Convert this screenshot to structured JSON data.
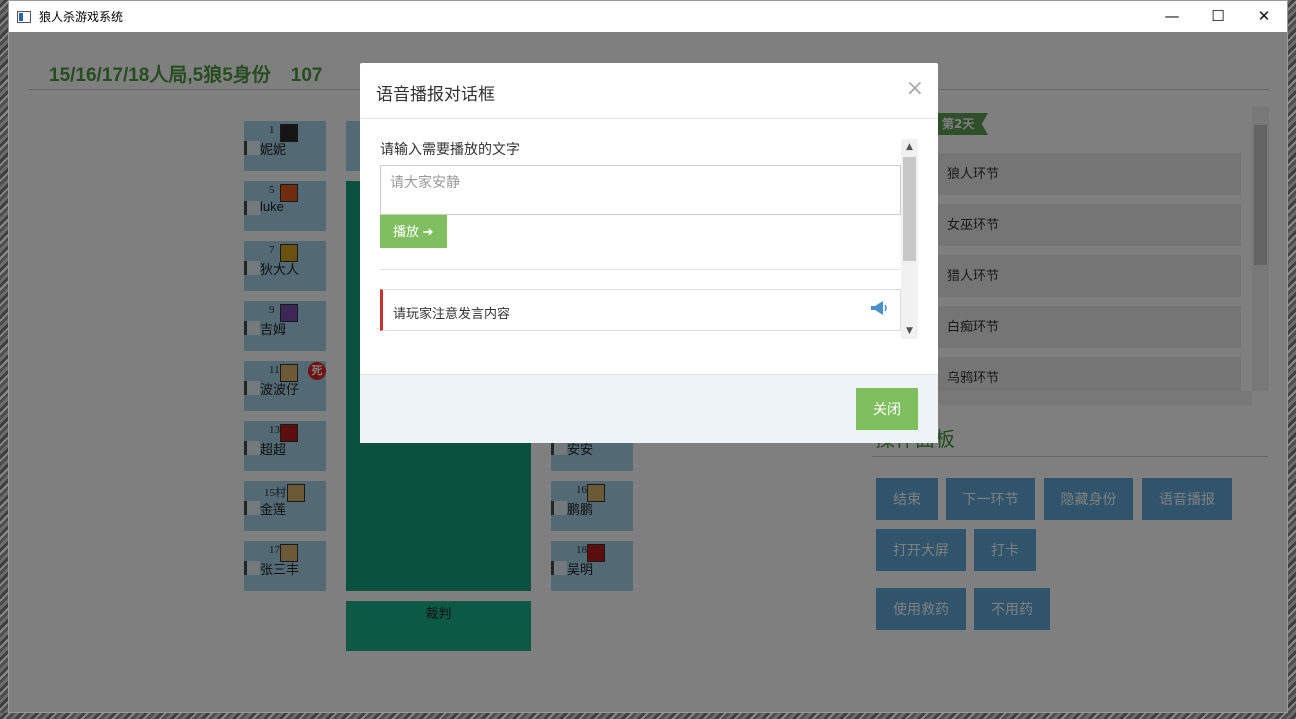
{
  "window": {
    "title": "狼人杀游戏系统",
    "controls": {
      "minimize": "—",
      "maximize": "☐",
      "close": "✕"
    }
  },
  "header": {
    "game_mode": "15/16/17/18人局,5狼5身份",
    "room_partial": "107",
    "flow_title_partial": "程"
  },
  "seats": [
    {
      "num": "1",
      "name": "妮妮",
      "role_color": "#2b2b2b",
      "dead": false
    },
    {
      "num": "5",
      "name": "luke",
      "role_color": "#e05a1a",
      "dead": false
    },
    {
      "num": "7",
      "name": "狄大人",
      "role_color": "#d6a21c",
      "dead": false
    },
    {
      "num": "9",
      "name": "吉姆",
      "role_color": "#7a4fb3",
      "dead": false
    },
    {
      "num": "11",
      "name": "波波仔",
      "role_color": "#d9b26a",
      "dead": true,
      "dead_label": "死"
    },
    {
      "num": "13",
      "name": "超超",
      "role_color": "#b81a1a",
      "dead": false
    },
    {
      "num": "15",
      "num_suffix": "村",
      "name": "金莲",
      "role_color": "#d9b26a",
      "dead": false
    },
    {
      "num": "17",
      "name": "张三丰",
      "role_color": "#d9b26a",
      "dead": false
    },
    {
      "num": "",
      "name": "安安",
      "role_color": "",
      "dead": false
    },
    {
      "num": "16",
      "name": "鹏鹏",
      "role_color": "#d9b26a",
      "dead": false
    },
    {
      "num": "18",
      "name": "吴明",
      "role_color": "#b81a1a",
      "dead": false
    }
  ],
  "judge_label": "裁判",
  "flow": {
    "day_tag": "第2天",
    "items": [
      "狼人环节",
      "女巫环节",
      "猎人环节",
      "白痴环节",
      "乌鸦环节"
    ]
  },
  "ops": {
    "title_partial": "操作面板",
    "buttons": [
      "结束",
      "下一环节",
      "隐藏身份",
      "语音播报",
      "打开大屏",
      "打卡",
      "使用救药",
      "不用药"
    ]
  },
  "modal": {
    "title": "语音播报对话框",
    "close_icon": "×",
    "field_label": "请输入需要播放的文字",
    "input_placeholder": "请大家安静",
    "play_label": "播放 ➔",
    "message": "请玩家注意发言内容",
    "close_label": "关闭"
  },
  "colors": {
    "accent_green": "#4a9a3e",
    "seat_blue": "#a6d2e6",
    "board_teal": "#13a07d",
    "button_green": "#7fbf5f",
    "op_blue": "#5ea9d9",
    "alert_red": "#c9302c"
  }
}
